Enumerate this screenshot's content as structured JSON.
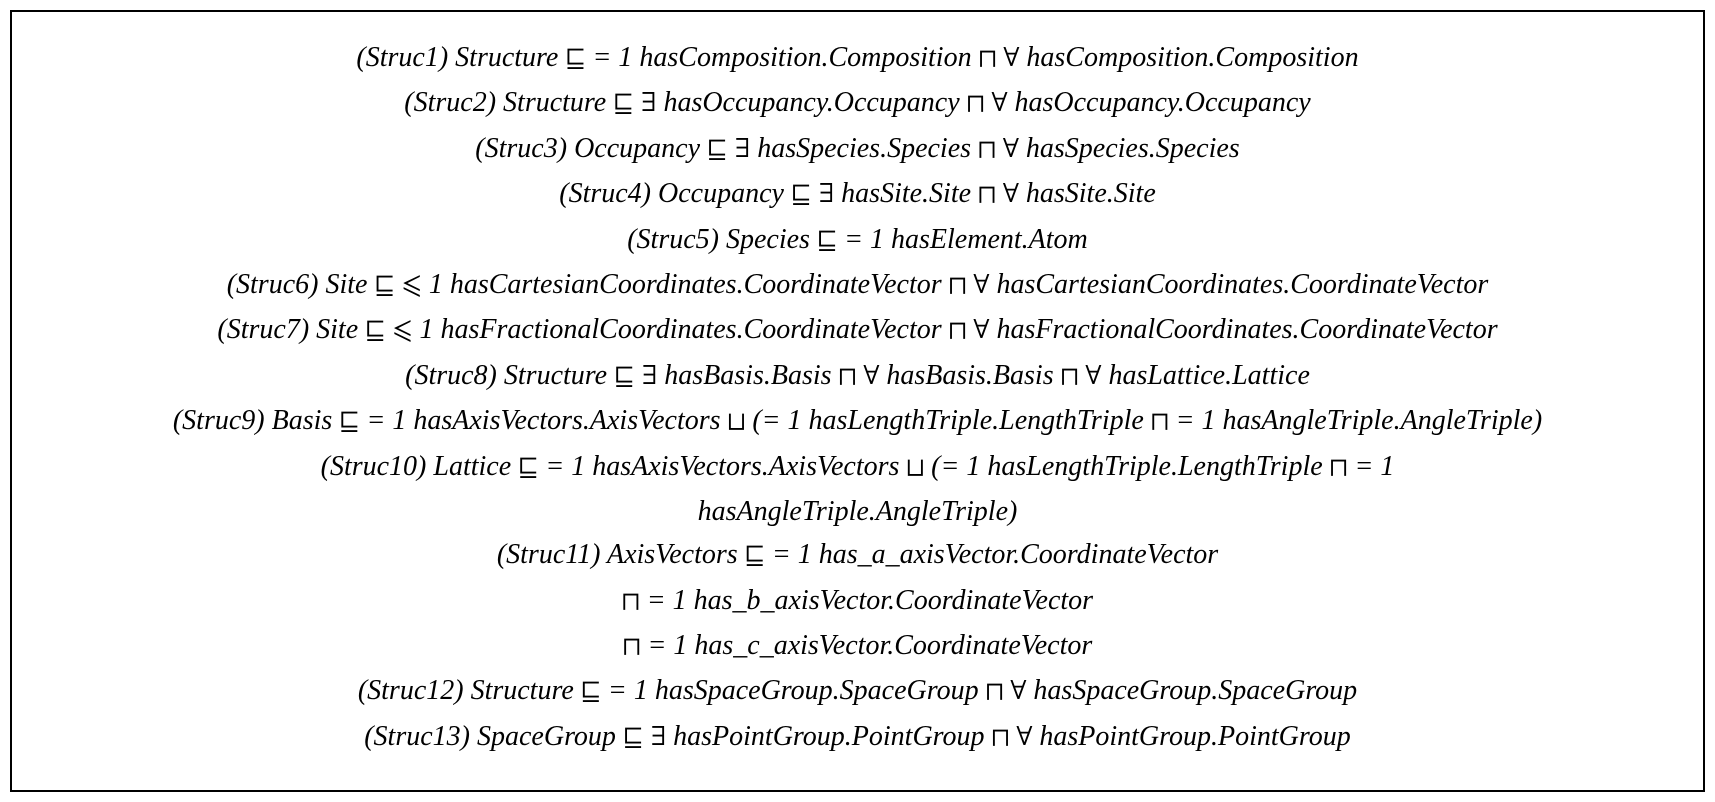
{
  "axioms": [
    {
      "label": "(Struc1)",
      "parts": [
        "Structure ",
        {
          "sym": "⊑"
        },
        " = 1 hasComposition.Composition ",
        {
          "sym": "⊓"
        },
        " ",
        {
          "sym": "∀"
        },
        " hasComposition.Composition"
      ]
    },
    {
      "label": "(Struc2)",
      "parts": [
        "Structure ",
        {
          "sym": "⊑"
        },
        " ",
        {
          "sym": "∃"
        },
        " hasOccupancy.Occupancy ",
        {
          "sym": "⊓"
        },
        " ",
        {
          "sym": "∀"
        },
        " hasOccupancy.Occupancy"
      ]
    },
    {
      "label": "(Struc3)",
      "parts": [
        "Occupancy ",
        {
          "sym": "⊑"
        },
        " ",
        {
          "sym": "∃"
        },
        " hasSpecies.Species ",
        {
          "sym": "⊓"
        },
        " ",
        {
          "sym": "∀"
        },
        " hasSpecies.Species"
      ]
    },
    {
      "label": "(Struc4)",
      "parts": [
        "Occupancy ",
        {
          "sym": "⊑"
        },
        " ",
        {
          "sym": "∃"
        },
        " hasSite.Site ",
        {
          "sym": "⊓"
        },
        " ",
        {
          "sym": "∀"
        },
        " hasSite.Site"
      ]
    },
    {
      "label": "(Struc5)",
      "parts": [
        "Species ",
        {
          "sym": "⊑"
        },
        " = 1 hasElement.Atom"
      ]
    },
    {
      "label": "(Struc6)",
      "parts": [
        "Site ",
        {
          "sym": "⊑"
        },
        " ",
        {
          "sym": "⩽"
        },
        " 1 hasCartesianCoordinates.CoordinateVector ",
        {
          "sym": "⊓"
        },
        " ",
        {
          "sym": "∀"
        },
        " hasCartesianCoordinates.CoordinateVector"
      ]
    },
    {
      "label": "(Struc7)",
      "parts": [
        "Site ",
        {
          "sym": "⊑"
        },
        " ",
        {
          "sym": "⩽"
        },
        " 1 hasFractionalCoordinates.CoordinateVector ",
        {
          "sym": "⊓"
        },
        " ",
        {
          "sym": "∀"
        },
        " hasFractionalCoordinates.CoordinateVector"
      ]
    },
    {
      "label": "(Struc8)",
      "parts": [
        "Structure ",
        {
          "sym": "⊑"
        },
        " ",
        {
          "sym": "∃"
        },
        " hasBasis.Basis ",
        {
          "sym": "⊓"
        },
        " ",
        {
          "sym": "∀"
        },
        " hasBasis.Basis ",
        {
          "sym": "⊓"
        },
        " ",
        {
          "sym": "∀"
        },
        " hasLattice.Lattice"
      ]
    },
    {
      "label": "(Struc9)",
      "parts": [
        "Basis ",
        {
          "sym": "⊑"
        },
        " = 1 hasAxisVectors.AxisVectors ",
        {
          "sym": "⊔"
        },
        " (= 1 hasLengthTriple.LengthTriple ",
        {
          "sym": "⊓"
        },
        " = 1 hasAngleTriple.AngleTriple)"
      ]
    },
    {
      "label": "(Struc10)",
      "parts": [
        "Lattice ",
        {
          "sym": "⊑"
        },
        " = 1 hasAxisVectors.AxisVectors ",
        {
          "sym": "⊔"
        },
        " (= 1 hasLengthTriple.LengthTriple ",
        {
          "sym": "⊓"
        },
        " = 1"
      ]
    },
    {
      "label": "",
      "parts": [
        "hasAngleTriple.AngleTriple)"
      ]
    },
    {
      "label": "(Struc11)",
      "parts": [
        "AxisVectors ",
        {
          "sym": "⊑"
        },
        " = 1 has_a_axisVector.CoordinateVector"
      ]
    },
    {
      "label": "",
      "parts": [
        {
          "sym": "⊓"
        },
        " = 1 has_b_axisVector.CoordinateVector"
      ]
    },
    {
      "label": "",
      "parts": [
        {
          "sym": "⊓"
        },
        " = 1 has_c_axisVector.CoordinateVector"
      ]
    },
    {
      "label": "(Struc12)",
      "parts": [
        "Structure ",
        {
          "sym": "⊑"
        },
        " = 1 hasSpaceGroup.SpaceGroup ",
        {
          "sym": "⊓"
        },
        " ",
        {
          "sym": "∀"
        },
        " hasSpaceGroup.SpaceGroup"
      ]
    },
    {
      "label": "(Struc13)",
      "parts": [
        "SpaceGroup ",
        {
          "sym": "⊑"
        },
        " ",
        {
          "sym": "∃"
        },
        " hasPointGroup.PointGroup ",
        {
          "sym": "⊓"
        },
        " ",
        {
          "sym": "∀"
        },
        " hasPointGroup.PointGroup"
      ]
    }
  ]
}
